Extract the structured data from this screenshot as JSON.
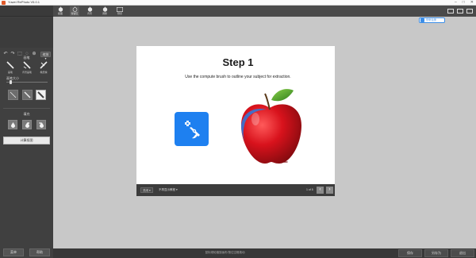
{
  "window": {
    "title": "Yuwei RePhoto V5.0.1",
    "controls": [
      "–",
      "□",
      "✕"
    ]
  },
  "left": {
    "toolbar_icons": [
      "undo-icon",
      "redo-icon",
      "rect-select-icon",
      "lasso-icon",
      "zoom-icon"
    ],
    "toolbar_select": "缩放 ▾",
    "brush_section_title": "画笔",
    "brushes": [
      {
        "label": "画笔"
      },
      {
        "label": "背景画笔"
      },
      {
        "label": "橡皮擦"
      }
    ],
    "size_label": "画笔大小",
    "size_fraction": 0.08,
    "shape_icons": [
      "thin-brush-icon",
      "medium-brush-icon",
      "thick-brush-icon"
    ],
    "fill_section_title": "填充",
    "fill_icons": [
      "drop-small-icon",
      "drop-medium-icon",
      "drop-large-icon"
    ],
    "apply_label": "计算抠图",
    "bottom_left_label": "菜单",
    "bottom_right_label": "帮助"
  },
  "topbar": {
    "tabs": [
      {
        "label": "抠图",
        "icon": "apple-icon"
      },
      {
        "label": "保留区",
        "icon": "apple-outline-icon"
      },
      {
        "label": "背景",
        "icon": "apple-icon"
      },
      {
        "label": "调整",
        "icon": "apple-icon"
      },
      {
        "label": "预览",
        "icon": "image-icon"
      }
    ],
    "login_badge": "登录/注册"
  },
  "tutorial": {
    "title": "Step 1",
    "subtitle": "Use the compute brush to outline your subject for extraction.",
    "prev_select": "关闭 ▾",
    "show_again": "不再显示教程 ▾",
    "page": "1 of 5"
  },
  "bottom": {
    "status": "鼠标滚轮缩放画布/按住空格拖动",
    "btn_save": "保存",
    "btn_saveas": "另存为",
    "btn_close": "退出"
  }
}
